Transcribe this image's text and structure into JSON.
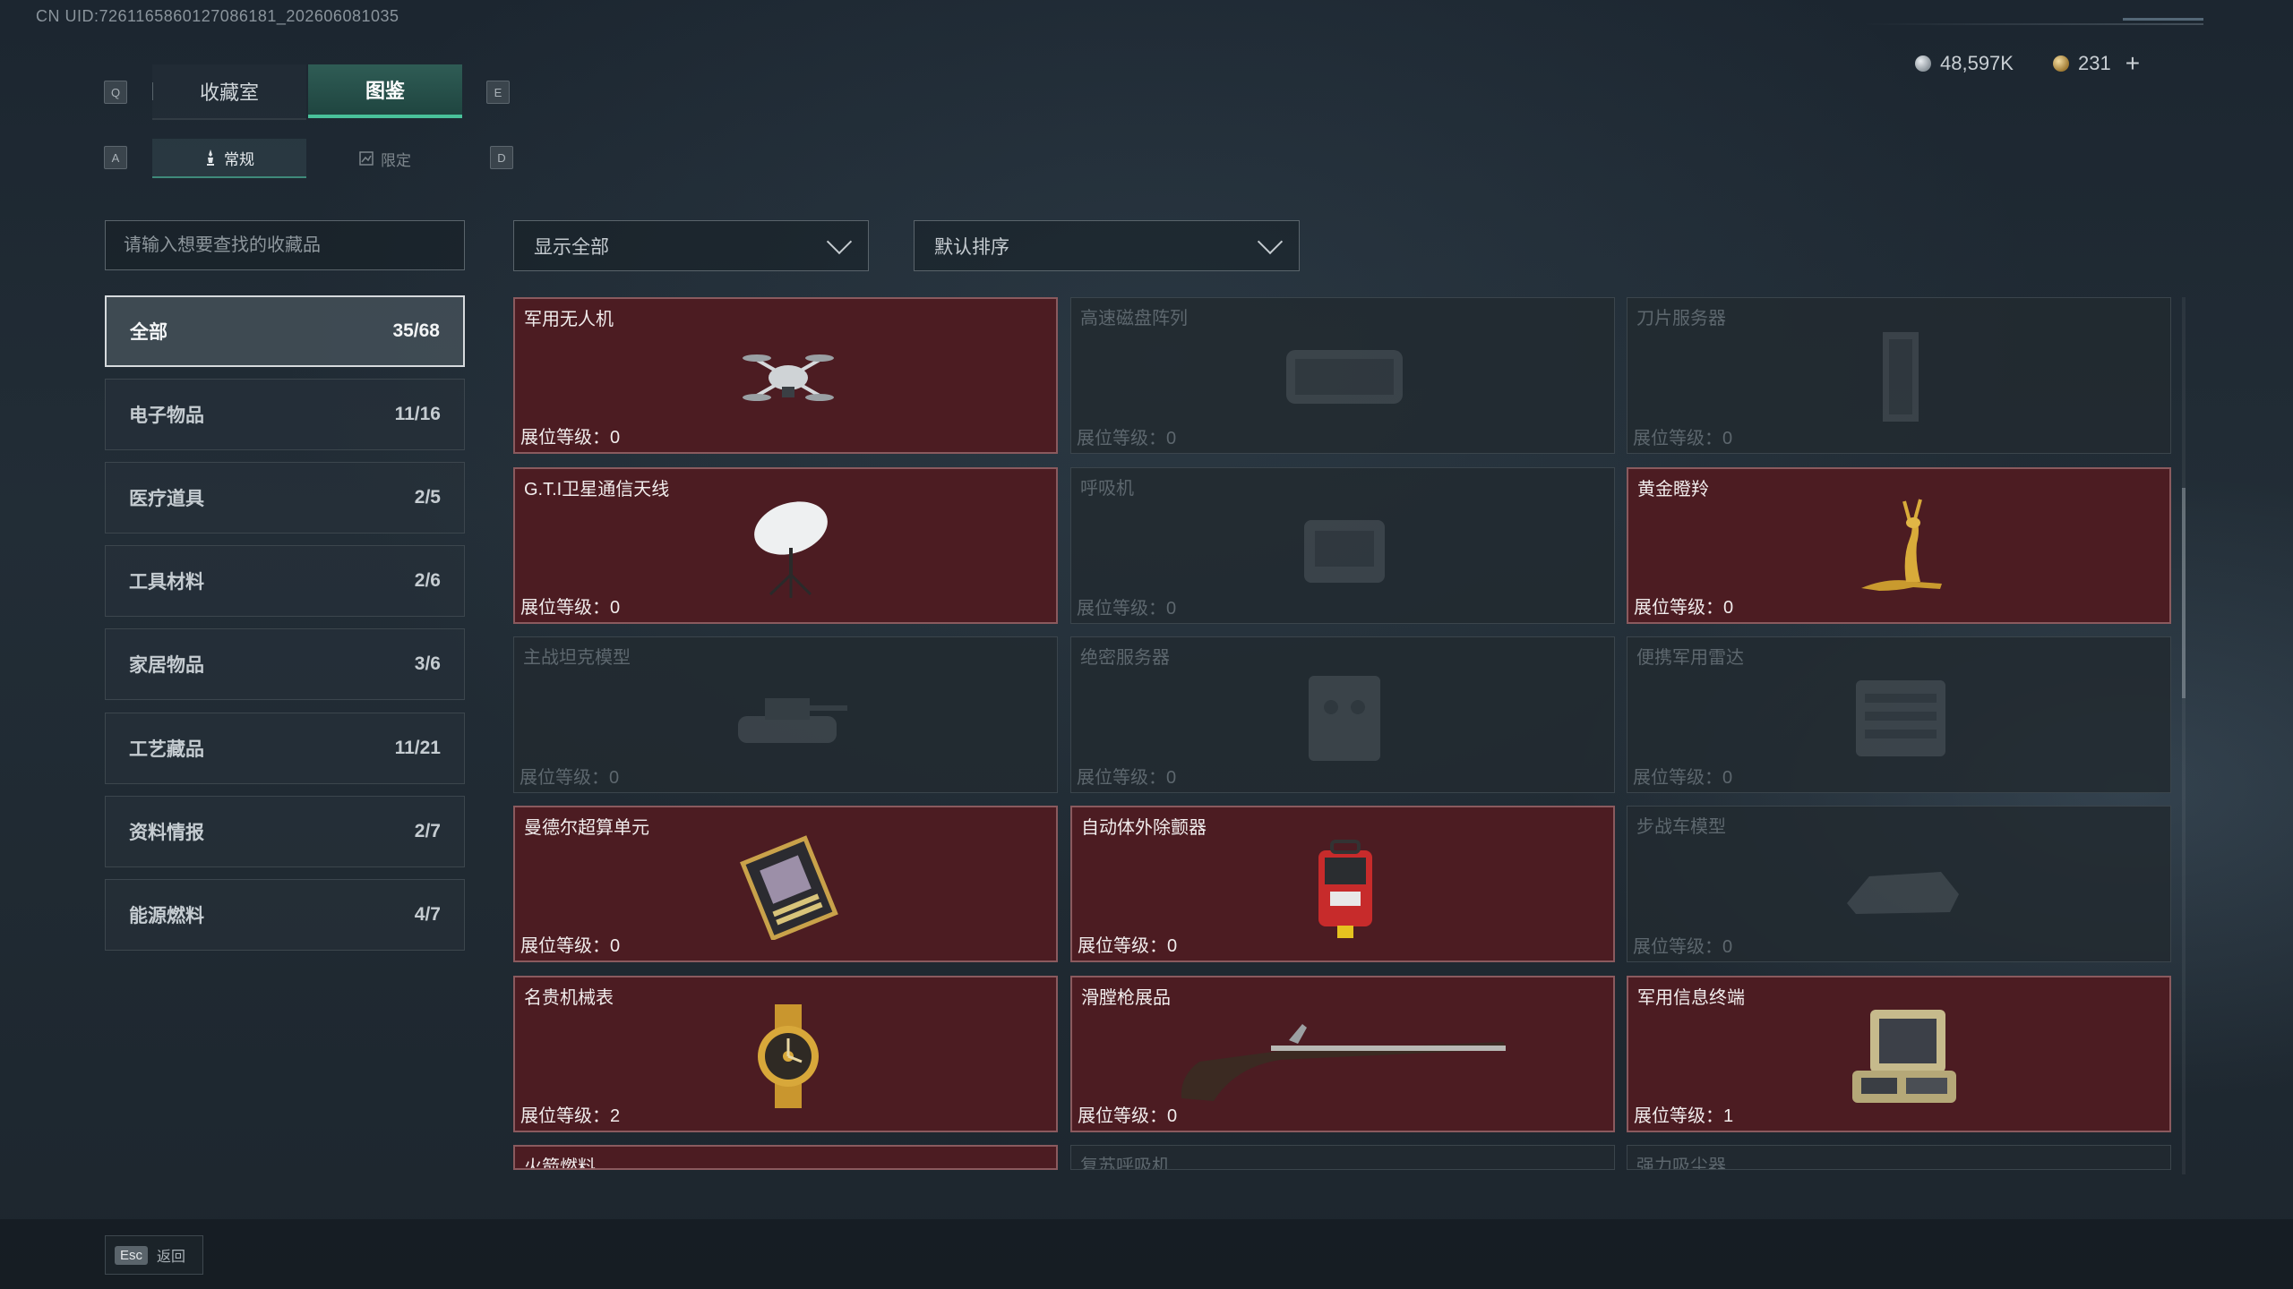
{
  "header": {
    "uid": "CN UID:7261165860127086181_202606081035",
    "currency": {
      "silver": "48,597K",
      "gold": "231",
      "add": "+"
    }
  },
  "keys": {
    "prev_tab": "Q",
    "next_tab": "E",
    "prev_sub": "A",
    "next_sub": "D"
  },
  "tabs": [
    {
      "label": "收藏室"
    },
    {
      "label": "图鉴"
    }
  ],
  "subtabs": [
    {
      "label": "常规"
    },
    {
      "label": "限定"
    }
  ],
  "search": {
    "placeholder": "请输入想要查找的收藏品"
  },
  "filters": {
    "show": "显示全部",
    "sort": "默认排序"
  },
  "categories": [
    {
      "label": "全部",
      "count": "35/68"
    },
    {
      "label": "电子物品",
      "count": "11/16"
    },
    {
      "label": "医疗道具",
      "count": "2/5"
    },
    {
      "label": "工具材料",
      "count": "2/6"
    },
    {
      "label": "家居物品",
      "count": "3/6"
    },
    {
      "label": "工艺藏品",
      "count": "11/21"
    },
    {
      "label": "资料情报",
      "count": "2/7"
    },
    {
      "label": "能源燃料",
      "count": "4/7"
    }
  ],
  "items": [
    {
      "name": "军用无人机",
      "level": "展位等级：0",
      "owned": true,
      "icon": "drone"
    },
    {
      "name": "高速磁盘阵列",
      "level": "展位等级：0",
      "owned": false,
      "icon": "disk-array"
    },
    {
      "name": "刀片服务器",
      "level": "展位等级：0",
      "owned": false,
      "icon": "blade-server"
    },
    {
      "name": "G.T.I卫星通信天线",
      "level": "展位等级：0",
      "owned": true,
      "icon": "satellite-dish"
    },
    {
      "name": "呼吸机",
      "level": "展位等级：0",
      "owned": false,
      "icon": "ventilator"
    },
    {
      "name": "黄金瞪羚",
      "level": "展位等级：0",
      "owned": true,
      "icon": "golden-gazelle"
    },
    {
      "name": "主战坦克模型",
      "level": "展位等级：0",
      "owned": false,
      "icon": "tank-model"
    },
    {
      "name": "绝密服务器",
      "level": "展位等级：0",
      "owned": false,
      "icon": "secret-server"
    },
    {
      "name": "便携军用雷达",
      "level": "展位等级：0",
      "owned": false,
      "icon": "radar"
    },
    {
      "name": "曼德尔超算单元",
      "level": "展位等级：0",
      "owned": true,
      "icon": "compute-unit"
    },
    {
      "name": "自动体外除颤器",
      "level": "展位等级：0",
      "owned": true,
      "icon": "defibrillator"
    },
    {
      "name": "步战车模型",
      "level": "展位等级：0",
      "owned": false,
      "icon": "ifv-model"
    },
    {
      "name": "名贵机械表",
      "level": "展位等级：2",
      "owned": true,
      "icon": "gold-watch"
    },
    {
      "name": "滑膛枪展品",
      "level": "展位等级：0",
      "owned": true,
      "icon": "musket"
    },
    {
      "name": "军用信息终端",
      "level": "展位等级：1",
      "owned": true,
      "icon": "info-terminal"
    },
    {
      "name": "火箭燃料",
      "owned": true,
      "icon": "rocket-fuel"
    },
    {
      "name": "复苏呼吸机",
      "owned": false,
      "icon": "resuscitator"
    },
    {
      "name": "强力吸尘器",
      "owned": false,
      "icon": "vacuum"
    }
  ],
  "footer": {
    "esc_key": "Esc",
    "esc_label": "返回"
  },
  "colors": {
    "owned_bg": "#4c1c22",
    "accent": "#49c19a",
    "locked_bg": "#222a30"
  }
}
